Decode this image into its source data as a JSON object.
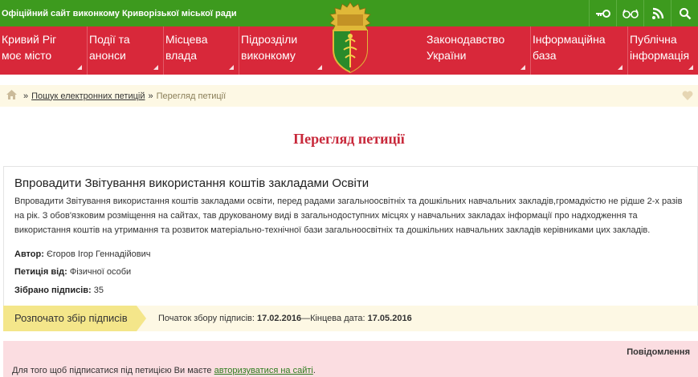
{
  "header": {
    "site_title": "Офіційний сайт виконкому Криворізької міської ради",
    "tools": [
      {
        "icon": "key-icon",
        "glyph": "⊶"
      },
      {
        "icon": "glasses-icon",
        "glyph": "ϭϭ"
      },
      {
        "icon": "rss-icon",
        "glyph": "⌇"
      },
      {
        "icon": "search-icon",
        "glyph": "⚲"
      }
    ]
  },
  "nav": {
    "items": [
      {
        "line1": "Кривий Ріг",
        "line2": "моє місто"
      },
      {
        "line1": "Події та",
        "line2": "анонси"
      },
      {
        "line1": "Місцева",
        "line2": "влада"
      },
      {
        "line1": "Підрозділи",
        "line2": "виконкому"
      },
      {
        "line1": "Законодавство",
        "line2": "України"
      },
      {
        "line1": "Інформаційна",
        "line2": "база"
      },
      {
        "line1": "Публічна",
        "line2": "інформація"
      }
    ]
  },
  "breadcrumb": {
    "sep1": "»",
    "link": "Пошук електронних петицій",
    "sep2": "»",
    "current": "Перегляд петиції"
  },
  "page_title": "Перегляд петиції",
  "petition": {
    "title": "Впровадити Звітування використання коштів закладами Освіти",
    "body": "Впровадити Звітування використання коштів закладами освіти, перед радами загальноосвітніх та дошкільних навчальних закладів,громадкістю  не рідше 2-х разів на рік. З обов'язковим розміщення на сайтах, тав друкованому виді в загальнодоступних місцях у навчальних закладах інформації про надходження та використання коштів на утримання та розвиток матеріально-технічної бази загальноосвітніх та дошкільних навчальних закладів керівниками цих  закладів.",
    "author_label": "Автор:",
    "author": "Єгоров Ігор Геннадійович",
    "from_label": "Петиція від:",
    "from": "Фізичної особи",
    "signatures_label": "Зібрано підписів:",
    "signatures": "35"
  },
  "status": {
    "badge": "Розпочато збір підписів",
    "start_label": "Початок збору підписів:",
    "start_date": "17.02.2016",
    "dash": "—",
    "end_label": "Кінцева дата:",
    "end_date": "17.05.2016"
  },
  "notice": {
    "heading": "Повідомлення",
    "text_before": "Для того щоб підписатися під петицією Ви маєте ",
    "link": "авторизуватися на сайті",
    "text_after": "."
  },
  "colors": {
    "topbar": "#3d9a1e",
    "nav": "#d8283a",
    "title_red": "#c8283a",
    "badge": "#f4e68a",
    "notice_bg": "#fbdde1"
  }
}
